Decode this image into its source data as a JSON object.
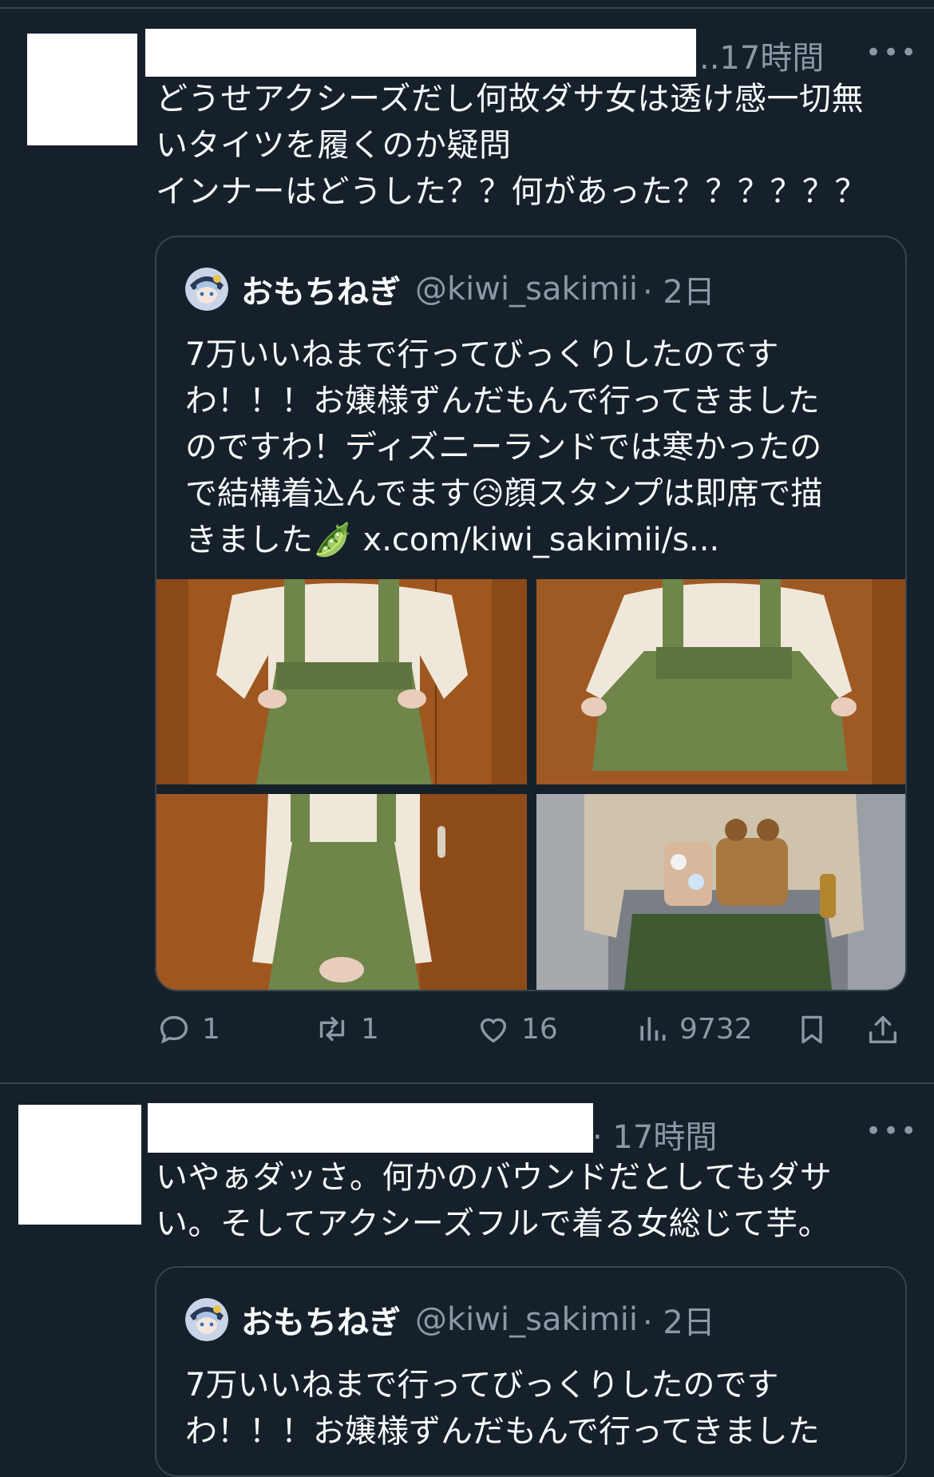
{
  "tweets": [
    {
      "time": "..17時間",
      "more": "•••",
      "text": "どうせアクシーズだし何故ダサ女は透け感一切無\nいタイツを履くのか疑問\nインナーはどうした？？何があった？？？？？？",
      "quote": {
        "name": "おもちねぎ",
        "handle": "@kiwi_sakimii",
        "time": "· 2日",
        "text": "7万いいねまで行ってびっくりしたのです\nわ！！！お嬢様ずんだもんで行ってきました\nのですわ！ディズニーランドでは寒かったの\nで結構着込んでます😥顔スタンプは即席で描\nきました🫛 x.com/kiwi_sakimii/s..."
      },
      "actions": {
        "reply_count": "1",
        "retweet_count": "1",
        "like_count": "16",
        "view_count": "9732"
      }
    },
    {
      "time": "· 17時間",
      "more": "•••",
      "text": "いやぁダッさ。何かのバウンドだとしてもダサ\nい。そしてアクシーズフルで着る女総じて芋。",
      "quote": {
        "name": "おもちねぎ",
        "handle": "@kiwi_sakimii",
        "time": "· 2日",
        "text": "7万いいねまで行ってびっくりしたのです\nわ！！！お嬢様ずんだもんで行ってきました"
      }
    }
  ],
  "icons": {
    "reply": "reply-icon",
    "retweet": "retweet-icon",
    "like": "heart-icon",
    "views": "views-icon",
    "bookmark": "bookmark-icon",
    "share": "share-icon"
  },
  "colors": {
    "background": "#15202b",
    "text": "#f7f9f9",
    "muted": "#8b98a5",
    "border": "#38444d",
    "skirt_green": "#6f8549",
    "door_wood": "#a0561f",
    "blouse": "#efe8da"
  }
}
